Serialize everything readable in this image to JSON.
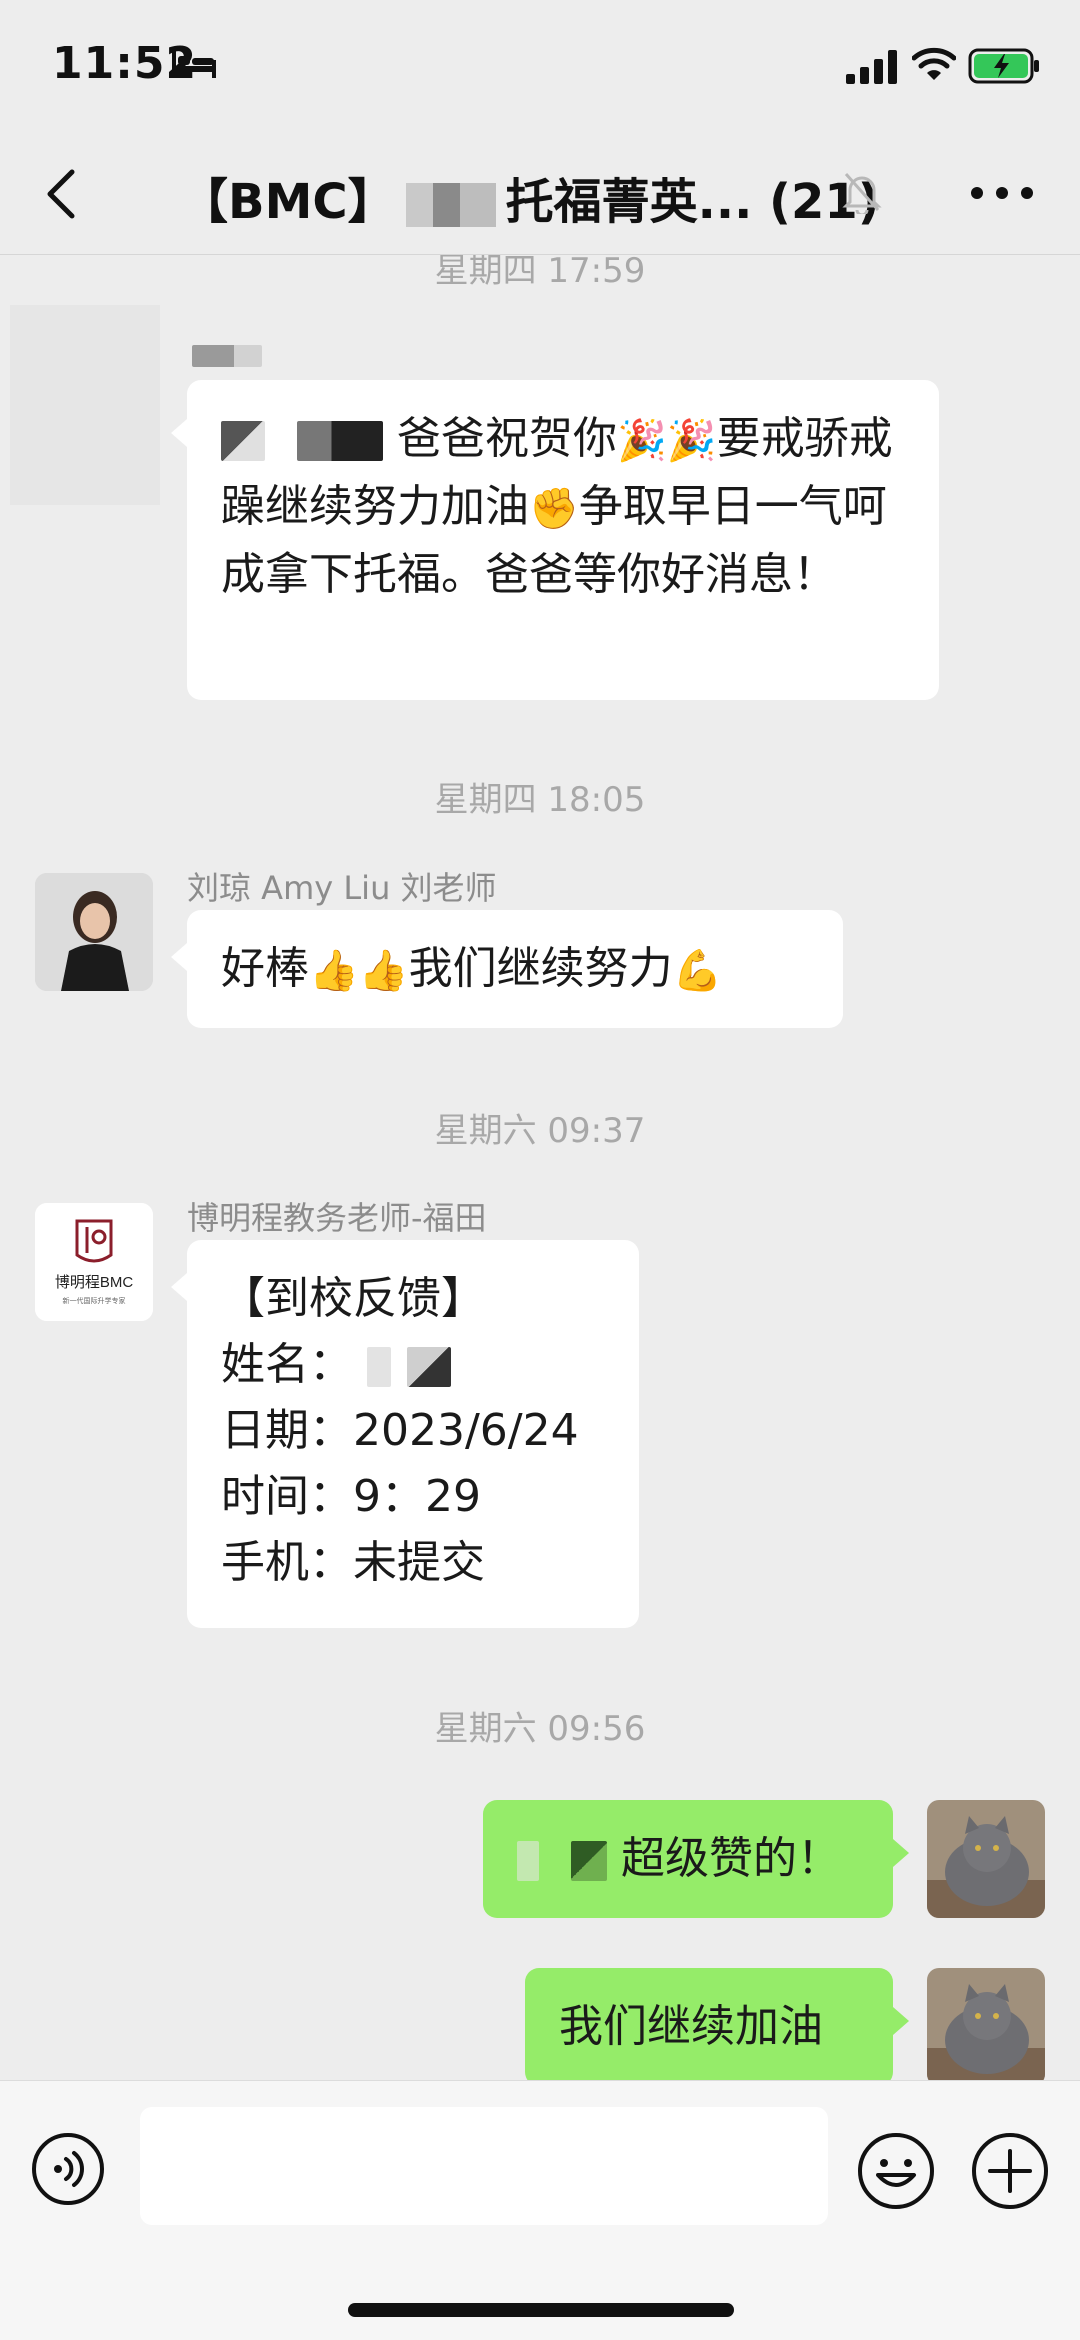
{
  "status_bar": {
    "time": "11:52"
  },
  "nav": {
    "title_prefix": "【BMC】",
    "title_suffix": "托福菁英...",
    "member_count": "(21)"
  },
  "chat": {
    "messages": [
      {
        "timestamp": "星期四 17:59",
        "text": "爸爸祝贺你",
        "text2": "要戒骄戒躁继续努力加油",
        "text3": "争取早日一气呵成拿下托福。爸爸等你好消息！",
        "emoji_1": "🎉",
        "emoji_2": "🎉",
        "emoji_3": "✊"
      },
      {
        "timestamp": "星期四 18:05",
        "sender": "刘琼 Amy Liu 刘老师",
        "text": "好棒",
        "text2": "我们继续努力",
        "emoji_1": "👍",
        "emoji_2": "👍",
        "emoji_3": "💪"
      },
      {
        "timestamp": "星期六 09:37",
        "sender": "博明程教务老师-福田",
        "avatar_logo": "博明程BMC",
        "avatar_tagline": "新一代国际升学专家",
        "lines": [
          "【到校反馈】",
          "姓名：",
          "日期：2023/6/24",
          "时间：9：29",
          "手机：未提交"
        ]
      },
      {
        "timestamp": "星期六 09:56",
        "text": "超级赞的！"
      },
      {
        "text": "我们继续加油"
      }
    ]
  },
  "icons": {
    "back": "chevron-left-icon",
    "mute": "bell-slash-icon",
    "more": "more-icon",
    "voice": "voice-icon",
    "emoji": "emoji-icon",
    "plus": "plus-icon"
  },
  "colors": {
    "background": "#ededed",
    "bubble_self": "#95ec69",
    "bubble_other": "#ffffff"
  }
}
